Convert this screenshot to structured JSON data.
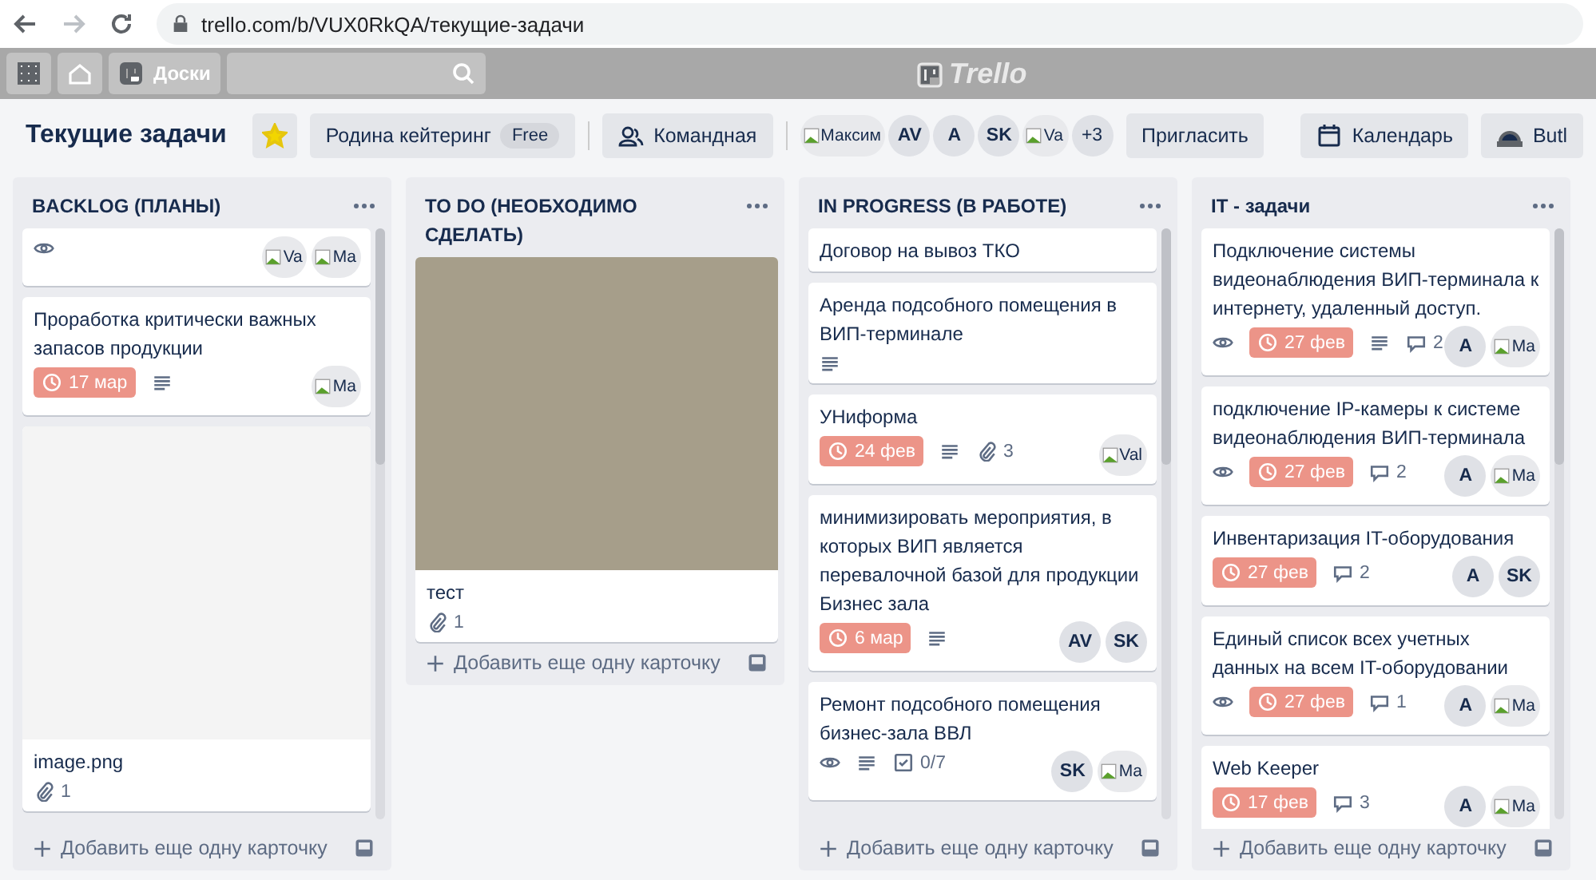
{
  "browser": {
    "url": "trello.com/b/VUX0RkQA/текущие-задачи",
    "back_disabled": false,
    "forward_disabled": true
  },
  "topbar": {
    "boards_label": "Доски",
    "logo": "Trello"
  },
  "board": {
    "title": "Текущие задачи",
    "starred": true,
    "team": "Родина кейтеринг",
    "plan": "Free",
    "visibility": "Командная",
    "members": [
      {
        "kind": "image",
        "alt": "Максим"
      },
      {
        "kind": "initials",
        "text": "AV"
      },
      {
        "kind": "initials",
        "text": "A"
      },
      {
        "kind": "initials",
        "text": "SK"
      },
      {
        "kind": "image",
        "alt": "Va"
      }
    ],
    "more_members": "+3",
    "invite": "Пригласить",
    "right_buttons": [
      {
        "kind": "calendar",
        "label": "Календарь"
      },
      {
        "kind": "butler",
        "label": "Butl"
      }
    ]
  },
  "lists": [
    {
      "title": "BACKLOG (ПЛАНЫ)",
      "add_label": "Добавить еще одну карточку",
      "scrollbar": true,
      "cards": [
        {
          "badges": [
            {
              "kind": "watch"
            }
          ],
          "members": [
            {
              "kind": "image",
              "alt": "Va"
            },
            {
              "kind": "image",
              "alt": "Ma"
            }
          ]
        },
        {
          "title": "Проработка критически важных запасов продукции",
          "badges": [
            {
              "kind": "due",
              "text": "17 мар"
            },
            {
              "kind": "description"
            }
          ],
          "members": [
            {
              "kind": "image",
              "alt": "Ma"
            }
          ]
        },
        {
          "color": "#f4f4f4",
          "title": "image.png",
          "badges": [
            {
              "kind": "attachments",
              "text": "1"
            }
          ]
        }
      ]
    },
    {
      "title": "TO DO (НЕОБХОДИМО СДЕЛАТЬ)",
      "add_label": "Добавить еще одну карточку",
      "scrollbar": false,
      "cards": [
        {
          "color": "#a69e8a",
          "title": "тест",
          "badges": [
            {
              "kind": "attachments",
              "text": "1"
            }
          ]
        }
      ]
    },
    {
      "title": "IN PROGRESS (В РАБОТЕ)",
      "add_label": "Добавить еще одну карточку",
      "scrollbar": true,
      "cards": [
        {
          "title": "Договор на вывоз ТКО"
        },
        {
          "title": "Аренда подсобного помещения в ВИП-терминале",
          "badges": [
            {
              "kind": "description"
            }
          ]
        },
        {
          "title": "УНиформа",
          "badges": [
            {
              "kind": "due",
              "text": "24 фев"
            },
            {
              "kind": "description"
            },
            {
              "kind": "attachments",
              "text": "3"
            }
          ],
          "members": [
            {
              "kind": "image",
              "alt": "Val"
            }
          ]
        },
        {
          "title": "минимизировать мероприятия, в которых ВИП является перевалочной базой для продукции Бизнес зала",
          "badges": [
            {
              "kind": "due",
              "text": "6 мар"
            },
            {
              "kind": "description"
            }
          ],
          "members": [
            {
              "kind": "initials",
              "text": "AV"
            },
            {
              "kind": "initials",
              "text": "SK"
            }
          ]
        },
        {
          "title": "Ремонт подсобного помещения бизнес-зала ВВЛ",
          "badges": [
            {
              "kind": "watch"
            },
            {
              "kind": "description"
            },
            {
              "kind": "checklist",
              "text": "0/7"
            }
          ],
          "members": [
            {
              "kind": "initials",
              "text": "SK"
            },
            {
              "kind": "image",
              "alt": "Ma"
            }
          ]
        }
      ]
    },
    {
      "title": "IT - задачи",
      "add_label": "Добавить еще одну карточку",
      "scrollbar": true,
      "cards": [
        {
          "title": "Подключение системы видеонаблюдения ВИП-терминала к интернету, удаленный доступ.",
          "badges": [
            {
              "kind": "watch"
            },
            {
              "kind": "due",
              "text": "27 фев"
            },
            {
              "kind": "description"
            },
            {
              "kind": "comments",
              "text": "2"
            }
          ],
          "members": [
            {
              "kind": "initials",
              "text": "A"
            },
            {
              "kind": "image",
              "alt": "Ma"
            }
          ]
        },
        {
          "title": "подключение IP-камеры к системе видеонаблюдения ВИП-терминала",
          "badges": [
            {
              "kind": "watch"
            },
            {
              "kind": "due",
              "text": "27 фев"
            },
            {
              "kind": "comments",
              "text": "2"
            }
          ],
          "members": [
            {
              "kind": "initials",
              "text": "A"
            },
            {
              "kind": "image",
              "alt": "Ma"
            }
          ]
        },
        {
          "title": "Инвентаризация IT-оборудования",
          "badges": [
            {
              "kind": "due",
              "text": "27 фев"
            },
            {
              "kind": "comments",
              "text": "2"
            }
          ],
          "members": [
            {
              "kind": "initials",
              "text": "A"
            },
            {
              "kind": "initials",
              "text": "SK"
            }
          ]
        },
        {
          "title": "Единый список всех учетных данных на всем IT-оборудовании",
          "badges": [
            {
              "kind": "watch"
            },
            {
              "kind": "due",
              "text": "27 фев"
            },
            {
              "kind": "comments",
              "text": "1"
            }
          ],
          "members": [
            {
              "kind": "initials",
              "text": "A"
            },
            {
              "kind": "image",
              "alt": "Ma"
            }
          ]
        },
        {
          "title": "Web Keeper",
          "badges": [
            {
              "kind": "due",
              "text": "17 фев"
            },
            {
              "kind": "comments",
              "text": "3"
            }
          ],
          "members": [
            {
              "kind": "initials",
              "text": "A"
            },
            {
              "kind": "image",
              "alt": "Ma"
            }
          ]
        }
      ]
    }
  ]
}
